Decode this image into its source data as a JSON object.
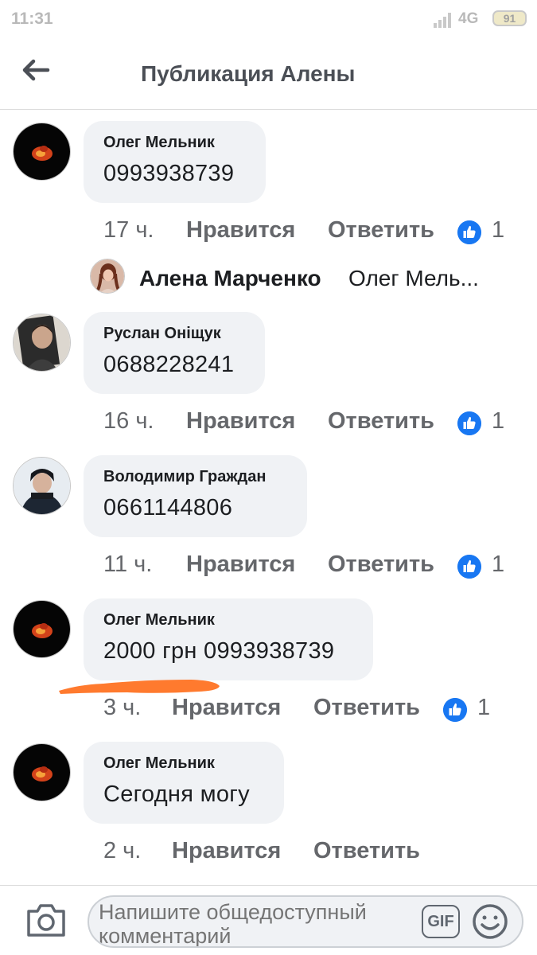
{
  "status_bar": {
    "time": "11:31",
    "network": "4G",
    "battery": "91"
  },
  "header": {
    "title": "Публикация Алены"
  },
  "comments": [
    {
      "author": "Олег Мельник",
      "text": "0993938739",
      "time": "17 ч.",
      "like_label": "Нравится",
      "reply_label": "Ответить",
      "likes": "1"
    },
    {
      "author": "Руслан Оніщук",
      "text": "0688228241",
      "time": "16 ч.",
      "like_label": "Нравится",
      "reply_label": "Ответить",
      "likes": "1"
    },
    {
      "author": "Володимир Граждан",
      "text": "0661144806",
      "time": "11 ч.",
      "like_label": "Нравится",
      "reply_label": "Ответить",
      "likes": "1"
    },
    {
      "author": "Олег Мельник",
      "text": "2000 грн 0993938739",
      "time": "3 ч.",
      "like_label": "Нравится",
      "reply_label": "Ответить",
      "likes": "1"
    },
    {
      "author": "Олег Мельник",
      "text": "Сегодня могу",
      "time": "2 ч.",
      "like_label": "Нравится",
      "reply_label": "Ответить"
    }
  ],
  "reply_preview": {
    "author": "Алена Марченко",
    "text": "Олег Мель..."
  },
  "composer": {
    "placeholder": "Напишите общедоступный комментарий",
    "gif_label": "GIF"
  },
  "icons": {
    "back": "arrow-left-icon",
    "like": "thumbs-up-icon",
    "camera": "camera-icon",
    "emoji": "smiley-icon"
  },
  "colors": {
    "like_blue": "#1877f2",
    "bubble_bg": "#f0f2f5",
    "scribble": "#ff7a2e"
  }
}
